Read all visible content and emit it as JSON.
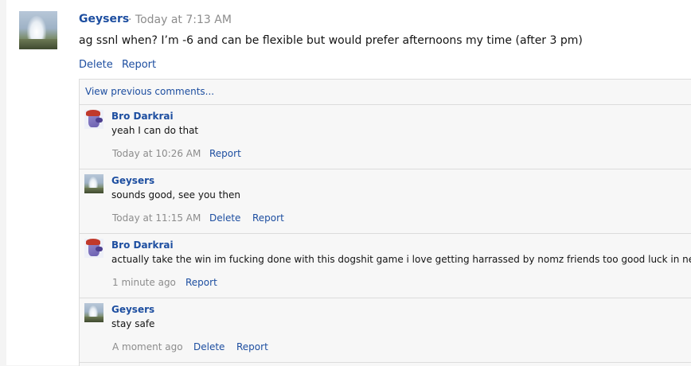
{
  "post": {
    "author": "Geysers",
    "meta": "· Today at 7:13 AM",
    "text": "ag ssnl when? I’m -6 and can be flexible but would prefer afternoons my time (after 3 pm)",
    "delete_label": "Delete",
    "report_label": "Report"
  },
  "comments_section": {
    "view_previous_label": "View previous comments...",
    "comments": [
      {
        "author": "Bro Darkrai",
        "avatar": "darkrai-avatar",
        "text": "yeah I can do that",
        "time": "Today at 10:26 AM",
        "report_label": "Report"
      },
      {
        "author": "Geysers",
        "avatar": "geyser-avatar",
        "text": "sounds good, see you then",
        "time": "Today at 11:15 AM",
        "delete_label": "Delete",
        "report_label": "Report"
      },
      {
        "author": "Bro Darkrai",
        "avatar": "darkrai-avatar",
        "text": "actually take the win im fucking done with this dogshit game i love getting harrassed by nomz friends too good luck in next",
        "time": "1 minute ago",
        "report_label": "Report"
      },
      {
        "author": "Geysers",
        "avatar": "geyser-avatar",
        "text": "stay safe",
        "time": "A moment ago",
        "delete_label": "Delete",
        "report_label": "Report"
      }
    ]
  },
  "colors": {
    "link": "#1d4ea0",
    "meta": "#8c8c8c",
    "panel": "#f7f7f7",
    "divider": "#dcdcdc"
  }
}
